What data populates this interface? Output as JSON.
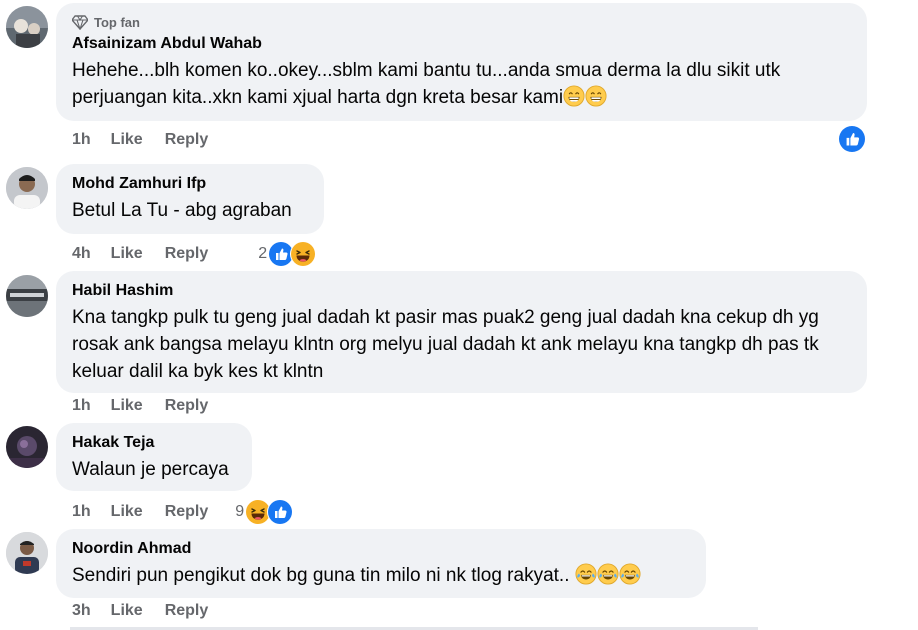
{
  "comments": [
    {
      "badge": "Top fan",
      "author": "Afsainizam Abdul Wahab",
      "text": "Hehehe...blh komen ko..okey...sblm kami bantu tu...anda smua derma la dlu sikit utk perjuangan kita..xkn kami xjual harta dgn kreta besar kami",
      "time": "1h",
      "like_label": "Like",
      "reply_label": "Reply",
      "reactions": [
        "like"
      ]
    },
    {
      "author": "Mohd Zamhuri Ifp",
      "text": "Betul La Tu - abg agraban",
      "time": "4h",
      "like_label": "Like",
      "reply_label": "Reply",
      "reaction_count": "2",
      "reactions": [
        "like",
        "haha"
      ]
    },
    {
      "author": "Habil Hashim",
      "text": "Kna tangkp pulk tu geng jual dadah kt pasir mas puak2 geng jual dadah kna cekup dh yg rosak ank bangsa melayu klntn org melyu jual dadah kt ank melayu kna tangkp dh pas tk keluar dalil ka byk kes kt klntn",
      "time": "1h",
      "like_label": "Like",
      "reply_label": "Reply"
    },
    {
      "author": "Hakak Teja",
      "text": "Walaun je percaya",
      "time": "1h",
      "like_label": "Like",
      "reply_label": "Reply",
      "reaction_count": "9",
      "reactions": [
        "haha",
        "like"
      ]
    },
    {
      "author": "Noordin Ahmad",
      "text": "Sendiri pun pengikut dok bg guna tin milo ni nk tlog rakyat..",
      "time": "3h",
      "like_label": "Like",
      "reply_label": "Reply"
    }
  ],
  "colors": {
    "bubble": "#f0f2f5",
    "like_blue": "#1877f2",
    "secondary_text": "#65676b",
    "haha_yellow": "#f7b125"
  }
}
